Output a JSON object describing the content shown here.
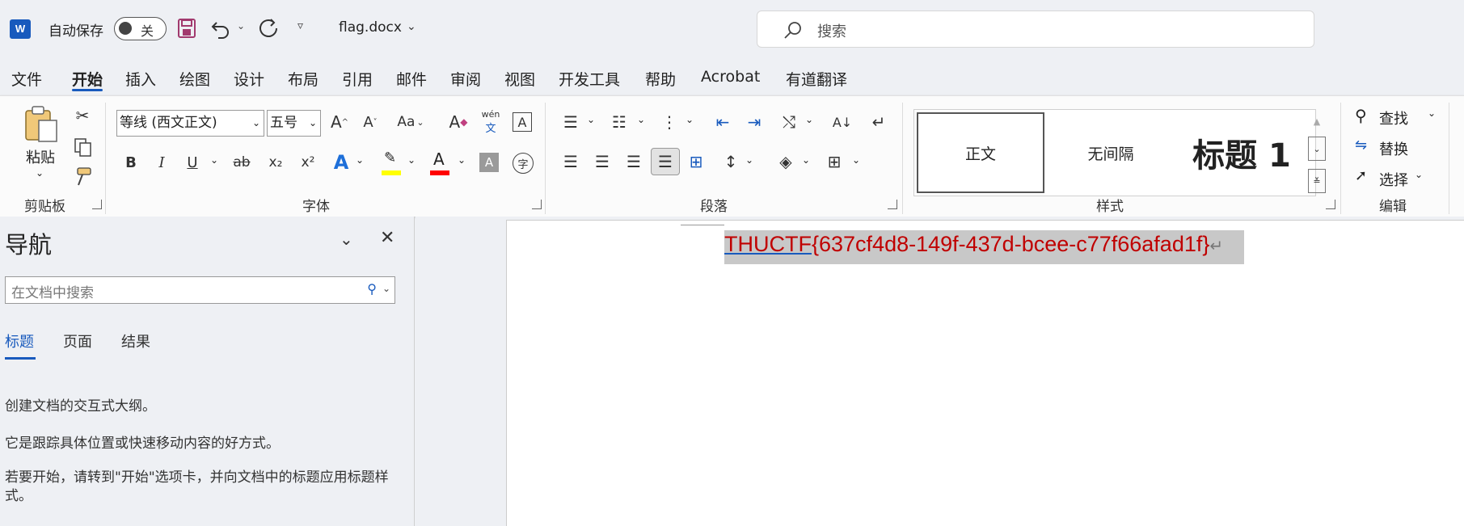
{
  "titlebar": {
    "app_logo": "W",
    "autosave_label": "自动保存",
    "autosave_state": "关",
    "filename": "flag.docx",
    "search_placeholder": "搜索"
  },
  "tabs": [
    "文件",
    "开始",
    "插入",
    "绘图",
    "设计",
    "布局",
    "引用",
    "邮件",
    "审阅",
    "视图",
    "开发工具",
    "帮助",
    "Acrobat",
    "有道翻译"
  ],
  "active_tab": "开始",
  "ribbon": {
    "clipboard": {
      "label": "剪贴板",
      "paste": "粘贴"
    },
    "font": {
      "label": "字体",
      "font_name": "等线 (西文正文)",
      "font_size": "五号",
      "phonetic_top": "wén",
      "phonetic_bottom": "文",
      "bold": "B",
      "italic": "I",
      "underline": "U",
      "strike": "ab",
      "sub": "x₂",
      "sup": "x²",
      "char_border": "A",
      "enclose": "字"
    },
    "paragraph": {
      "label": "段落"
    },
    "styles": {
      "label": "样式",
      "items": [
        "正文",
        "无间隔",
        "标题 1"
      ]
    },
    "editing": {
      "label": "编辑",
      "find": "查找",
      "replace": "替换",
      "select": "选择"
    }
  },
  "nav": {
    "title": "导航",
    "search_placeholder": "在文档中搜索",
    "tabs": [
      "标题",
      "页面",
      "结果"
    ],
    "messages": [
      "创建文档的交互式大纲。",
      "它是跟踪具体位置或快速移动内容的好方式。",
      "若要开始，请转到\"开始\"选项卡，并向文档中的标题应用标题样式。"
    ]
  },
  "document": {
    "text_prefix": "THUCTF",
    "text_rest": "{637cf4d8-149f-437d-bcee-c77f66afad1f}",
    "paragraph_mark": "↵"
  },
  "colors": {
    "accent": "#185abd",
    "doc_text": "#c00000",
    "selection": "#c8c8c8",
    "highlight": "#ffff00",
    "font_color": "#ff0000"
  }
}
